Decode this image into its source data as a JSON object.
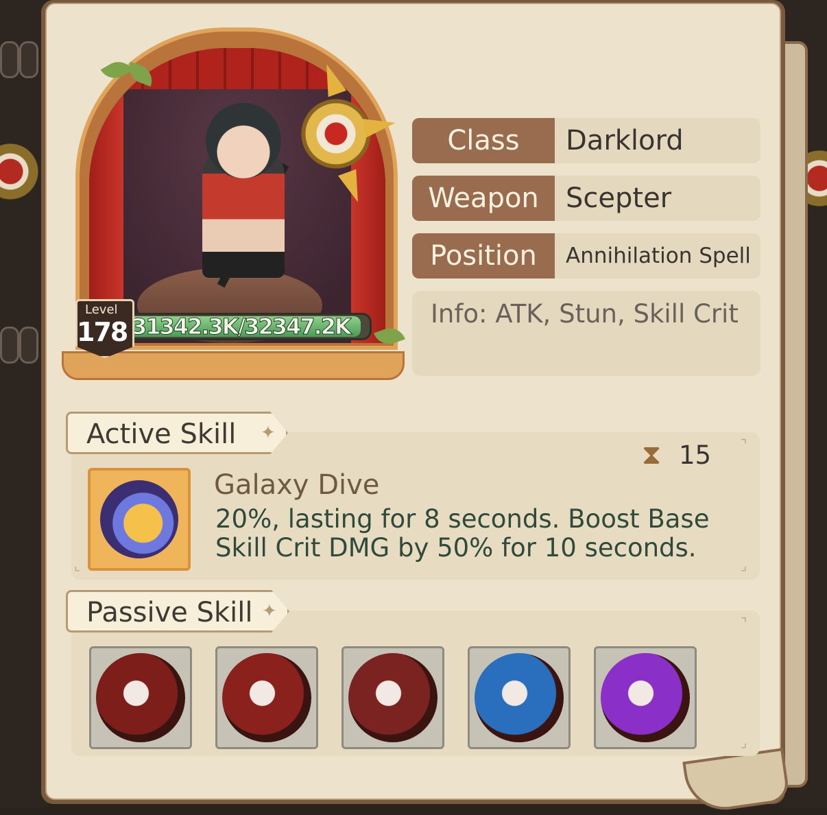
{
  "hero": {
    "level_label": "Level",
    "level": "178",
    "hp_text": "31342.3K/32347.2K",
    "hp_fraction": 0.969
  },
  "info": {
    "rows": [
      {
        "key": "Class",
        "value": "Darklord"
      },
      {
        "key": "Weapon",
        "value": "Scepter"
      },
      {
        "key": "Position",
        "value": "Annihilation Spell"
      }
    ],
    "description": "Info: ATK, Stun, Skill Crit"
  },
  "active_skill": {
    "section_title": "Active Skill",
    "name": "Galaxy Dive",
    "cooldown": "15",
    "description": "20%, lasting for 8 seconds. Boost Base Skill Crit DMG by 50% for 10 seconds."
  },
  "passive_skill": {
    "section_title": "Passive Skill",
    "icons": [
      {
        "icon": "fire-comet-icon",
        "color": "#7e1e1a"
      },
      {
        "icon": "flame-claw-icon",
        "color": "#8a211c"
      },
      {
        "icon": "tornado-icon",
        "color": "#7a2320"
      },
      {
        "icon": "water-vortex-icon",
        "color": "#2a6fbd"
      },
      {
        "icon": "arcane-burst-icon",
        "color": "#8a2fc7"
      }
    ]
  }
}
